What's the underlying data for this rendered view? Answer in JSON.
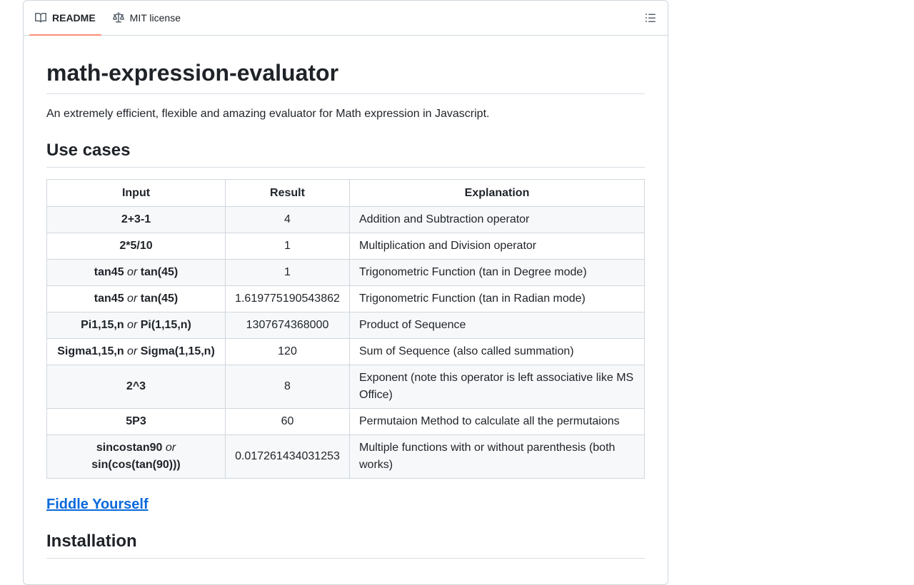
{
  "tabs": [
    {
      "label": "README",
      "icon": "book-icon",
      "active": true
    },
    {
      "label": "MIT license",
      "icon": "law-icon",
      "active": false
    }
  ],
  "outline_icon": "list-unordered-icon",
  "readme": {
    "title": "math-expression-evaluator",
    "description": "An extremely efficient, flexible and amazing evaluator for Math expression in Javascript.",
    "use_cases_heading": "Use cases",
    "table": {
      "headers": [
        "Input",
        "Result",
        "Explanation"
      ],
      "rows": [
        {
          "input": [
            "2+3-1"
          ],
          "result": "4",
          "explanation": "Addition and Subtraction operator"
        },
        {
          "input": [
            "2*5/10"
          ],
          "result": "1",
          "explanation": "Multiplication and Division operator"
        },
        {
          "input": [
            "tan45",
            "tan(45)"
          ],
          "result": "1",
          "explanation": "Trigonometric Function (tan in Degree mode)"
        },
        {
          "input": [
            "tan45",
            "tan(45)"
          ],
          "result": "1.619775190543862",
          "explanation": "Trigonometric Function (tan in Radian mode)"
        },
        {
          "input": [
            "Pi1,15,n",
            "Pi(1,15,n)"
          ],
          "result": "1307674368000",
          "explanation": "Product of Sequence"
        },
        {
          "input": [
            "Sigma1,15,n",
            "Sigma(1,15,n)"
          ],
          "result": "120",
          "explanation": "Sum of Sequence (also called summation)"
        },
        {
          "input": [
            "2^3"
          ],
          "result": "8",
          "explanation": "Exponent (note this operator is left associative like MS Office)"
        },
        {
          "input": [
            "5P3"
          ],
          "result": "60",
          "explanation": "Permutaion Method to calculate all the permutaions"
        },
        {
          "input": [
            "sincostan90",
            "sin(cos(tan(90)))"
          ],
          "result": "0.017261434031253",
          "explanation": "Multiple functions with or without parenthesis (both works)"
        }
      ],
      "or_word": "or"
    },
    "fiddle_link": "Fiddle Yourself",
    "installation_heading": "Installation"
  },
  "colors": {
    "link": "#0969da",
    "active_tab_underline": "#fd8c73",
    "border": "#d0d7de"
  }
}
